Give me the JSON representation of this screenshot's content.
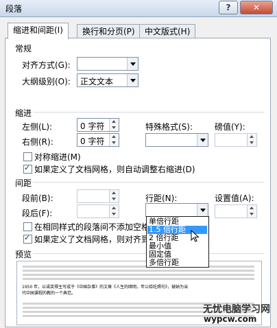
{
  "window": {
    "title": "段落",
    "help_label": "?",
    "close_label": "✕"
  },
  "tabs": [
    {
      "label": "缩进和间距(I)"
    },
    {
      "label": "换行和分页(P)"
    },
    {
      "label": "中文版式(H)"
    }
  ],
  "general": {
    "heading": "常规",
    "alignment_label": "对齐方式(G):",
    "alignment_value": "",
    "outline_label": "大纲级别(O):",
    "outline_value": "正文文本"
  },
  "indent": {
    "heading": "缩进",
    "left_label": "左侧(L):",
    "left_value": "0 字符",
    "right_label": "右侧(R):",
    "right_value": "0 字符",
    "special_label": "特殊格式(S):",
    "special_value": "",
    "by_label": "磅值(Y):",
    "by_value": "",
    "mirror_label": "对称缩进(M)",
    "mirror_checked": false,
    "auto_adjust_label": "如果定义了文档网格，则自动调整右缩进(D)",
    "auto_adjust_checked": true
  },
  "spacing": {
    "heading": "间距",
    "before_label": "段前(B):",
    "before_value": "",
    "after_label": "段后(F):",
    "after_value": "",
    "line_label": "行距(N):",
    "line_value": "",
    "at_label": "设置值(A):",
    "at_value": "",
    "no_space_label": "在相同样式的段落间不添加空格",
    "no_space_checked": false,
    "snap_label": "如果定义了文档网格，则对齐到",
    "snap_checked": true
  },
  "line_spacing_options": [
    {
      "label": "单倍行距",
      "selected": false
    },
    {
      "label": "1.5 倍行距",
      "selected": true
    },
    {
      "label": "2 倍行距",
      "selected": false
    },
    {
      "label": "最小值",
      "selected": false
    },
    {
      "label": "固定值",
      "selected": false
    },
    {
      "label": "多倍行距",
      "selected": false
    }
  ],
  "preview": {
    "heading": "预览",
    "text_line1": "1950 年，以诺奖得主写成于《中国杂事》的文章《人生的暗明，年公给吃照句》，被纳为当",
    "text_line2": "代中国课程的教的一个典范。"
  },
  "watermark": {
    "text": "无忧电脑学习网",
    "url": "wypcw.com"
  }
}
